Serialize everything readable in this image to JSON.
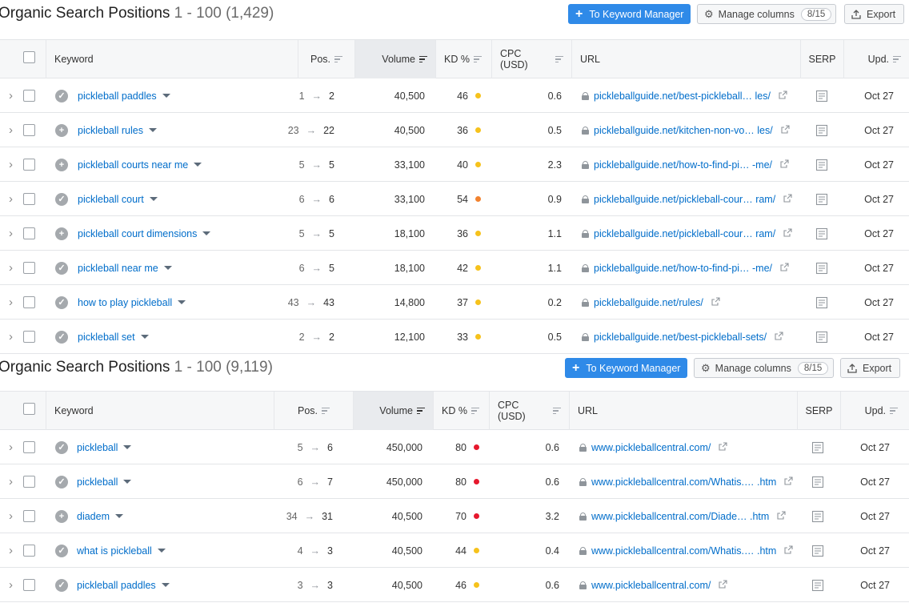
{
  "panels": [
    {
      "title": "Organic Search Positions",
      "range": "1 - 100 (1,429)",
      "toolbar": {
        "keyword_manager": "To Keyword Manager",
        "manage_columns": "Manage columns",
        "columns_count": "8/15",
        "export": "Export"
      },
      "headers": [
        "Keyword",
        "Pos.",
        "Volume",
        "KD %",
        "CPC (USD)",
        "URL",
        "SERP",
        "Upd."
      ],
      "rows": [
        {
          "status": "check",
          "keyword": "pickleball paddles",
          "pos_from": "1",
          "pos_to": "2",
          "volume": "40,500",
          "kd": "46",
          "kd_level": "yellow",
          "cpc": "0.6",
          "url": "pickleballguide.net/best-pickleball… les/",
          "upd": "Oct 27"
        },
        {
          "status": "plus",
          "keyword": "pickleball rules",
          "pos_from": "23",
          "pos_to": "22",
          "volume": "40,500",
          "kd": "36",
          "kd_level": "yellow",
          "cpc": "0.5",
          "url": "pickleballguide.net/kitchen-non-vo… les/",
          "upd": "Oct 27"
        },
        {
          "status": "plus",
          "keyword": "pickleball courts near me",
          "pos_from": "5",
          "pos_to": "5",
          "volume": "33,100",
          "kd": "40",
          "kd_level": "yellow",
          "cpc": "2.3",
          "url": "pickleballguide.net/how-to-find-pi… -me/",
          "upd": "Oct 27"
        },
        {
          "status": "check",
          "keyword": "pickleball court",
          "pos_from": "6",
          "pos_to": "6",
          "volume": "33,100",
          "kd": "54",
          "kd_level": "orange",
          "cpc": "0.9",
          "url": "pickleballguide.net/pickleball-cour… ram/",
          "upd": "Oct 27"
        },
        {
          "status": "plus",
          "keyword": "pickleball court dimensions",
          "pos_from": "5",
          "pos_to": "5",
          "volume": "18,100",
          "kd": "36",
          "kd_level": "yellow",
          "cpc": "1.1",
          "url": "pickleballguide.net/pickleball-cour… ram/",
          "upd": "Oct 27"
        },
        {
          "status": "check",
          "keyword": "pickleball near me",
          "pos_from": "6",
          "pos_to": "5",
          "volume": "18,100",
          "kd": "42",
          "kd_level": "yellow",
          "cpc": "1.1",
          "url": "pickleballguide.net/how-to-find-pi… -me/",
          "upd": "Oct 27"
        },
        {
          "status": "check",
          "keyword": "how to play pickleball",
          "pos_from": "43",
          "pos_to": "43",
          "volume": "14,800",
          "kd": "37",
          "kd_level": "yellow",
          "cpc": "0.2",
          "url": "pickleballguide.net/rules/",
          "upd": "Oct 27"
        },
        {
          "status": "check",
          "keyword": "pickleball set",
          "pos_from": "2",
          "pos_to": "2",
          "volume": "12,100",
          "kd": "33",
          "kd_level": "yellow",
          "cpc": "0.5",
          "url": "pickleballguide.net/best-pickleball-sets/",
          "upd": "Oct 27"
        }
      ]
    },
    {
      "title": "Organic Search Positions",
      "range": "1 - 100 (9,119)",
      "toolbar": {
        "keyword_manager": "To Keyword Manager",
        "manage_columns": "Manage columns",
        "columns_count": "8/15",
        "export": "Export"
      },
      "headers": [
        "Keyword",
        "Pos.",
        "Volume",
        "KD %",
        "CPC (USD)",
        "URL",
        "SERP",
        "Upd."
      ],
      "rows": [
        {
          "status": "check",
          "keyword": "pickleball",
          "pos_from": "5",
          "pos_to": "6",
          "volume": "450,000",
          "kd": "80",
          "kd_level": "red",
          "cpc": "0.6",
          "url": "www.pickleballcentral.com/",
          "upd": "Oct 27"
        },
        {
          "status": "check",
          "keyword": "pickleball",
          "pos_from": "6",
          "pos_to": "7",
          "volume": "450,000",
          "kd": "80",
          "kd_level": "red",
          "cpc": "0.6",
          "url": "www.pickleballcentral.com/Whatis.… .htm",
          "upd": "Oct 27"
        },
        {
          "status": "plus",
          "keyword": "diadem",
          "pos_from": "34",
          "pos_to": "31",
          "volume": "40,500",
          "kd": "70",
          "kd_level": "red",
          "cpc": "3.2",
          "url": "www.pickleballcentral.com/Diade… .htm",
          "upd": "Oct 27"
        },
        {
          "status": "check",
          "keyword": "what is pickleball",
          "pos_from": "4",
          "pos_to": "3",
          "volume": "40,500",
          "kd": "44",
          "kd_level": "yellow",
          "cpc": "0.4",
          "url": "www.pickleballcentral.com/Whatis.… .htm",
          "upd": "Oct 27"
        },
        {
          "status": "check",
          "keyword": "pickleball paddles",
          "pos_from": "3",
          "pos_to": "3",
          "volume": "40,500",
          "kd": "46",
          "kd_level": "yellow",
          "cpc": "0.6",
          "url": "www.pickleballcentral.com/",
          "upd": "Oct 27"
        }
      ]
    }
  ],
  "colors": {
    "accent": "#2f8ae8",
    "link": "#006dca",
    "kd_yellow": "#f6c21c",
    "kd_orange": "#f2822e",
    "kd_red": "#e6182d"
  },
  "icons": {
    "expand": "chevron-right-icon",
    "check": "check-circle-icon",
    "plus": "plus-circle-icon",
    "lock": "lock-icon",
    "external": "external-link-icon",
    "serp": "serp-document-icon",
    "gear": "gear-icon",
    "export": "upload-icon"
  }
}
